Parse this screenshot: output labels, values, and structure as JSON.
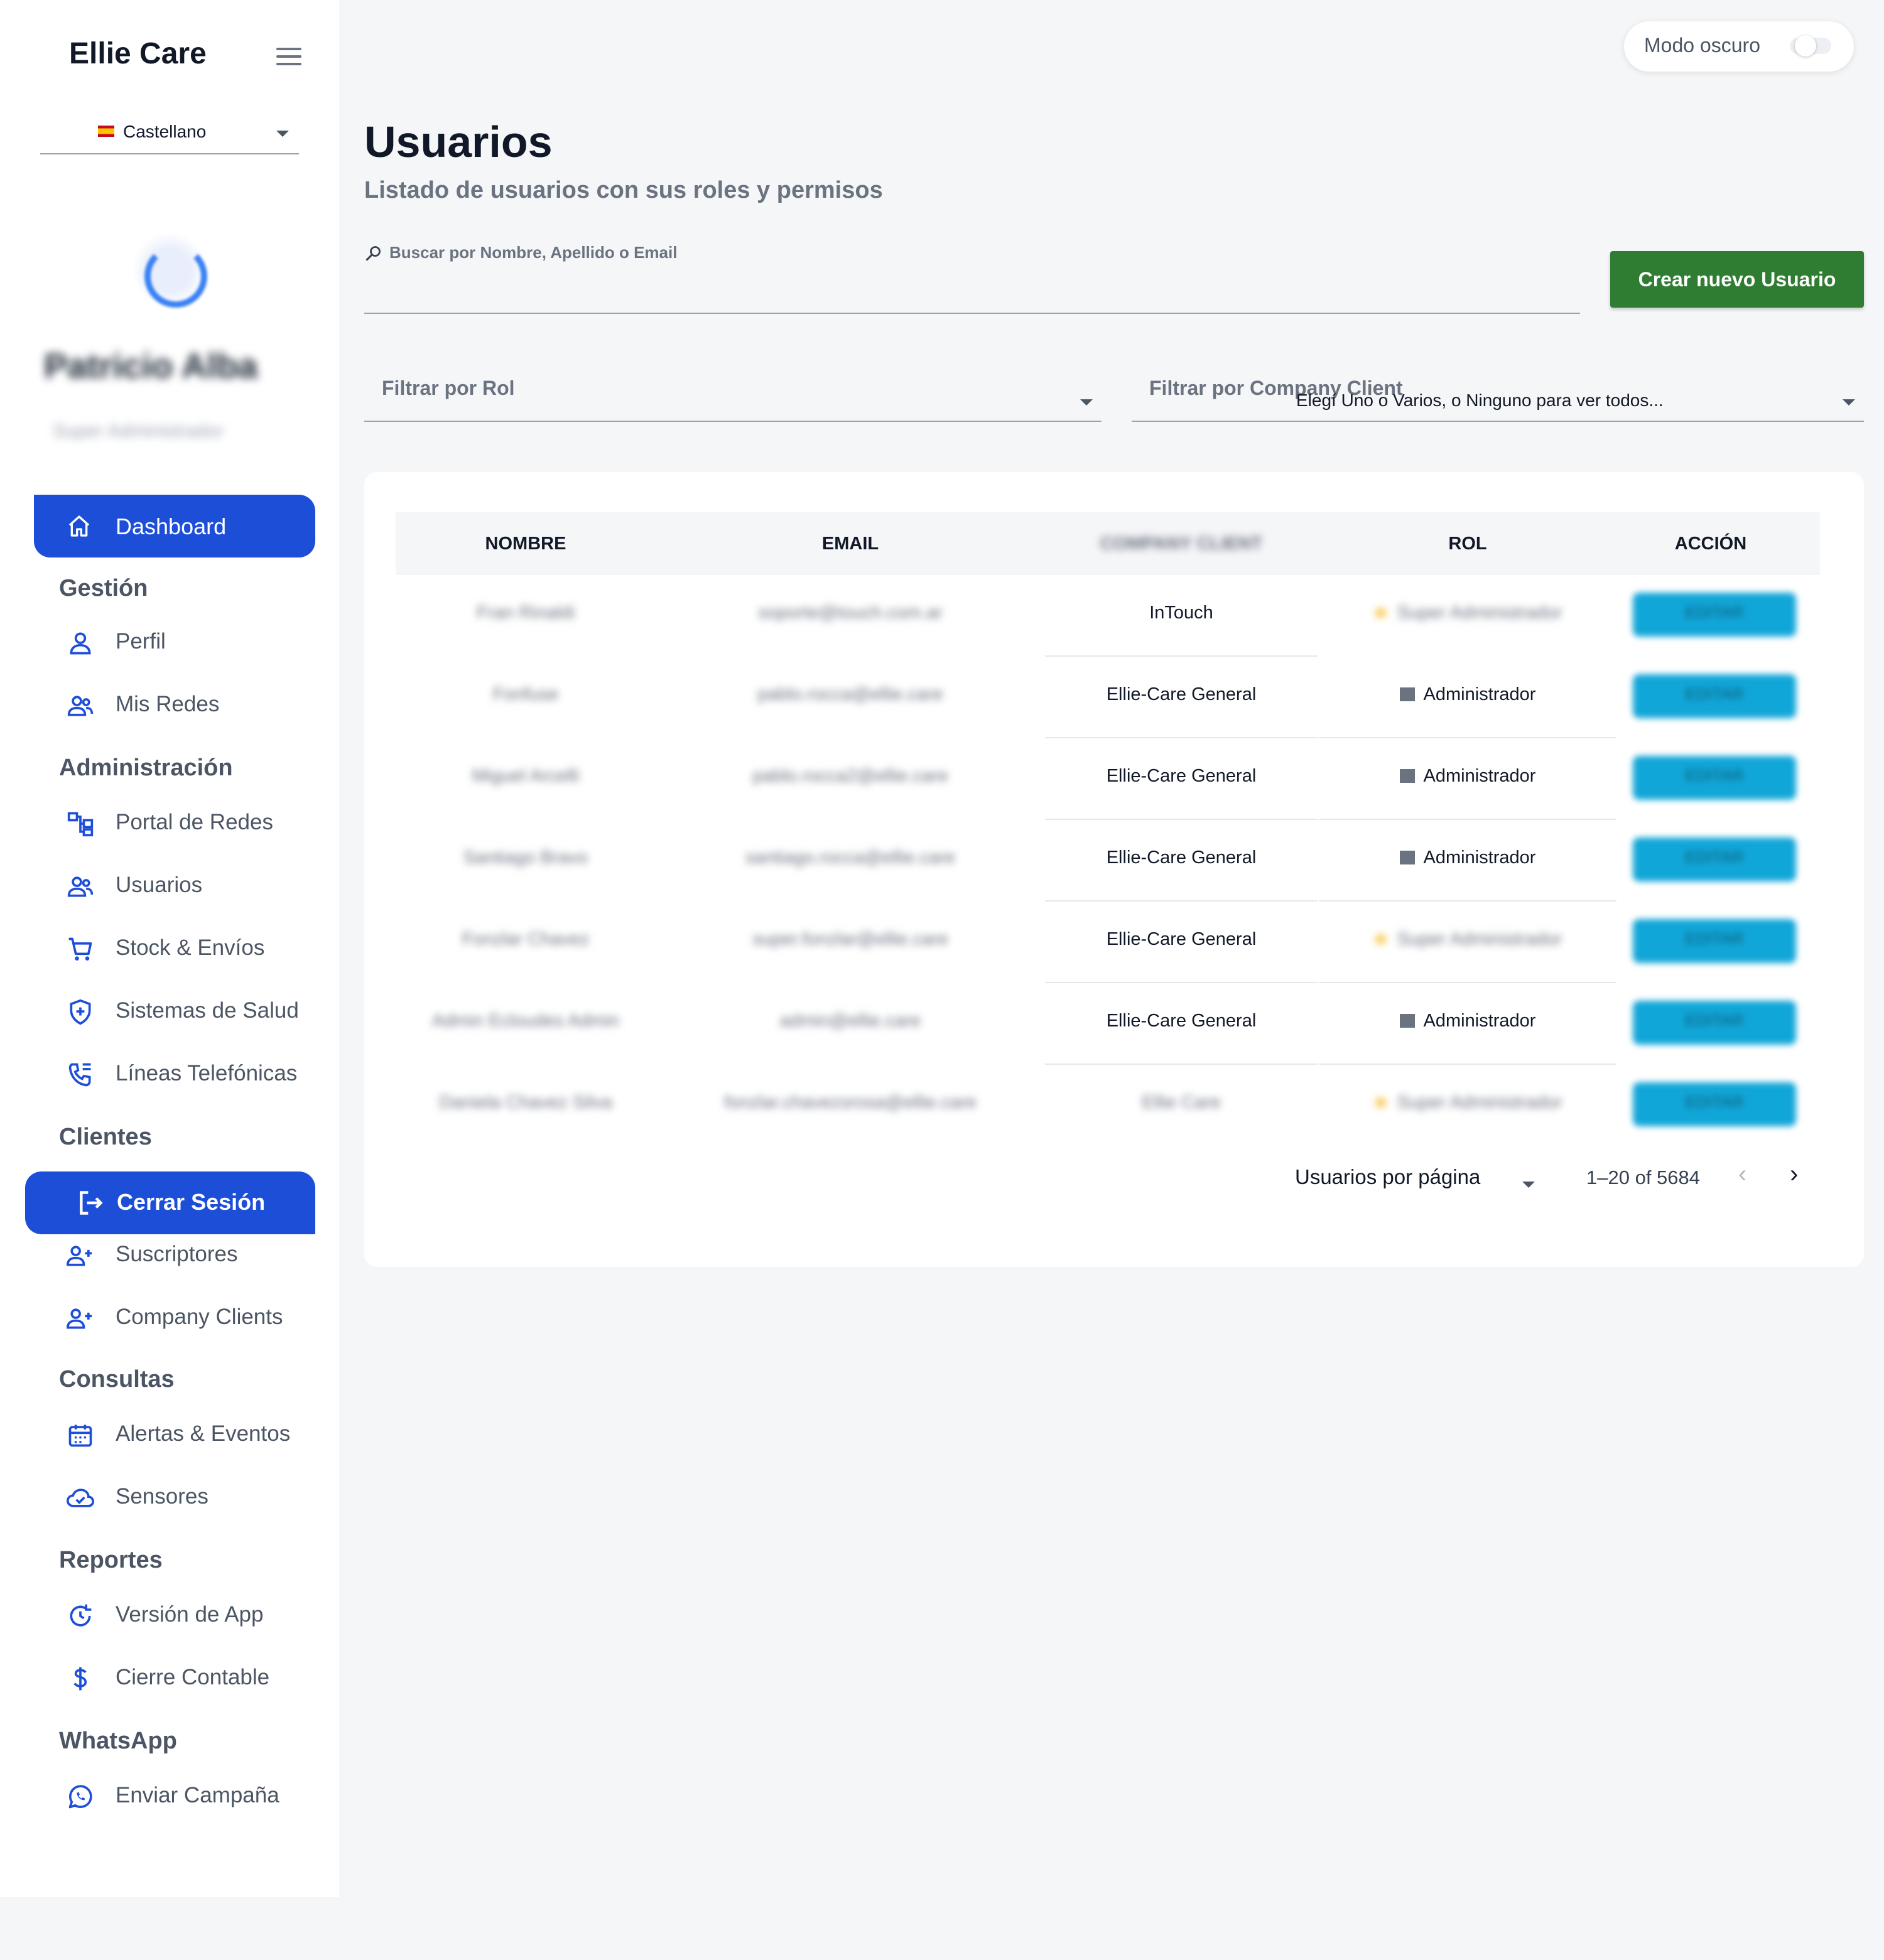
{
  "app": {
    "title": "Ellie Care"
  },
  "language": {
    "label": "Castellano"
  },
  "profile": {
    "name": "Patricio Alba",
    "role": "Super Administrador"
  },
  "nav": {
    "dashboard": "Dashboard",
    "sections": [
      {
        "title": "Gestión",
        "items": [
          {
            "label": "Perfil",
            "icon": "person-icon"
          },
          {
            "label": "Mis Redes",
            "icon": "group-icon"
          }
        ]
      },
      {
        "title": "Administración",
        "items": [
          {
            "label": "Portal de Redes",
            "icon": "network-icon"
          },
          {
            "label": "Usuarios",
            "icon": "group-icon"
          },
          {
            "label": "Stock & Envíos",
            "icon": "cart-icon"
          },
          {
            "label": "Sistemas de Salud",
            "icon": "shield-plus-icon"
          },
          {
            "label": "Líneas Telefónicas",
            "icon": "phone-icon"
          }
        ]
      },
      {
        "title": "Clientes",
        "items": [
          {
            "label": "Suscriptores",
            "icon": "person-add-icon"
          },
          {
            "label": "Company Clients",
            "icon": "person-add-icon"
          }
        ]
      },
      {
        "title": "Consultas",
        "items": [
          {
            "label": "Alertas & Eventos",
            "icon": "calendar-icon"
          },
          {
            "label": "Sensores",
            "icon": "cloud-check-icon"
          }
        ]
      },
      {
        "title": "Reportes",
        "items": [
          {
            "label": "Versión de App",
            "icon": "history-icon"
          },
          {
            "label": "Cierre Contable",
            "icon": "dollar-icon"
          }
        ]
      },
      {
        "title": "WhatsApp",
        "items": [
          {
            "label": "Enviar Campaña",
            "icon": "whatsapp-icon"
          }
        ]
      }
    ],
    "logout": "Cerrar Sesión"
  },
  "header": {
    "dark_mode_label": "Modo oscuro"
  },
  "page": {
    "title": "Usuarios",
    "subtitle": "Listado de usuarios con sus roles y permisos",
    "search_placeholder": "Buscar por Nombre, Apellido o Email",
    "create_button": "Crear nuevo Usuario",
    "filter_role_label": "Filtrar por Rol",
    "filter_company_label": "Filtrar por Company Client",
    "filter_company_placeholder": "Elegí Uno o Varios, o Ninguno para ver todos..."
  },
  "table": {
    "headers": {
      "name": "NOMBRE",
      "email": "EMAIL",
      "company": "COMPANY CLIENT",
      "role": "ROL",
      "action": "ACCIÓN"
    },
    "rows": [
      {
        "name": "Fran Rinaldi",
        "email": "soporte@touch.com.ar",
        "company": "InTouch",
        "role": "Super Administrador",
        "role_icon": "star-icon",
        "action": "EDITAR"
      },
      {
        "name": "Fonfuse",
        "email": "pablo.rocca@ellie.care",
        "company": "Ellie-Care General",
        "role": "Administrador",
        "role_icon": "building-icon",
        "action": "EDITAR"
      },
      {
        "name": "Miguel Arcelli",
        "email": "pablo.rocca2@ellie.care",
        "company": "Ellie-Care General",
        "role": "Administrador",
        "role_icon": "building-icon",
        "action": "EDITAR"
      },
      {
        "name": "Santiago Bravo",
        "email": "santiago.rocca@ellie.care",
        "company": "Ellie-Care General",
        "role": "Administrador",
        "role_icon": "building-icon",
        "action": "EDITAR"
      },
      {
        "name": "Fonzlar Chavez",
        "email": "super.fonzlar@ellie.care",
        "company": "Ellie-Care General",
        "role": "Super Administrador",
        "role_icon": "star-icon",
        "action": "EDITAR"
      },
      {
        "name": "Admin Ecloudes Admin",
        "email": "admin@ellie.care",
        "company": "Ellie-Care General",
        "role": "Administrador",
        "role_icon": "building-icon",
        "action": "EDITAR"
      },
      {
        "name": "Daniela Chavez Silva",
        "email": "fonzlar.chavezsrosa@ellie.care",
        "company": "Ellie Care",
        "role": "Super Administrador",
        "role_icon": "star-icon",
        "action": "EDITAR"
      }
    ]
  },
  "pagination": {
    "rows_per_page_label": "Usuarios por página",
    "range": "1–20 of 5684"
  },
  "colors": {
    "primary": "#1d4ed8",
    "create": "#2e7d32",
    "action": "#11a6d8",
    "sidebar_icon": "#1d4ed8"
  }
}
